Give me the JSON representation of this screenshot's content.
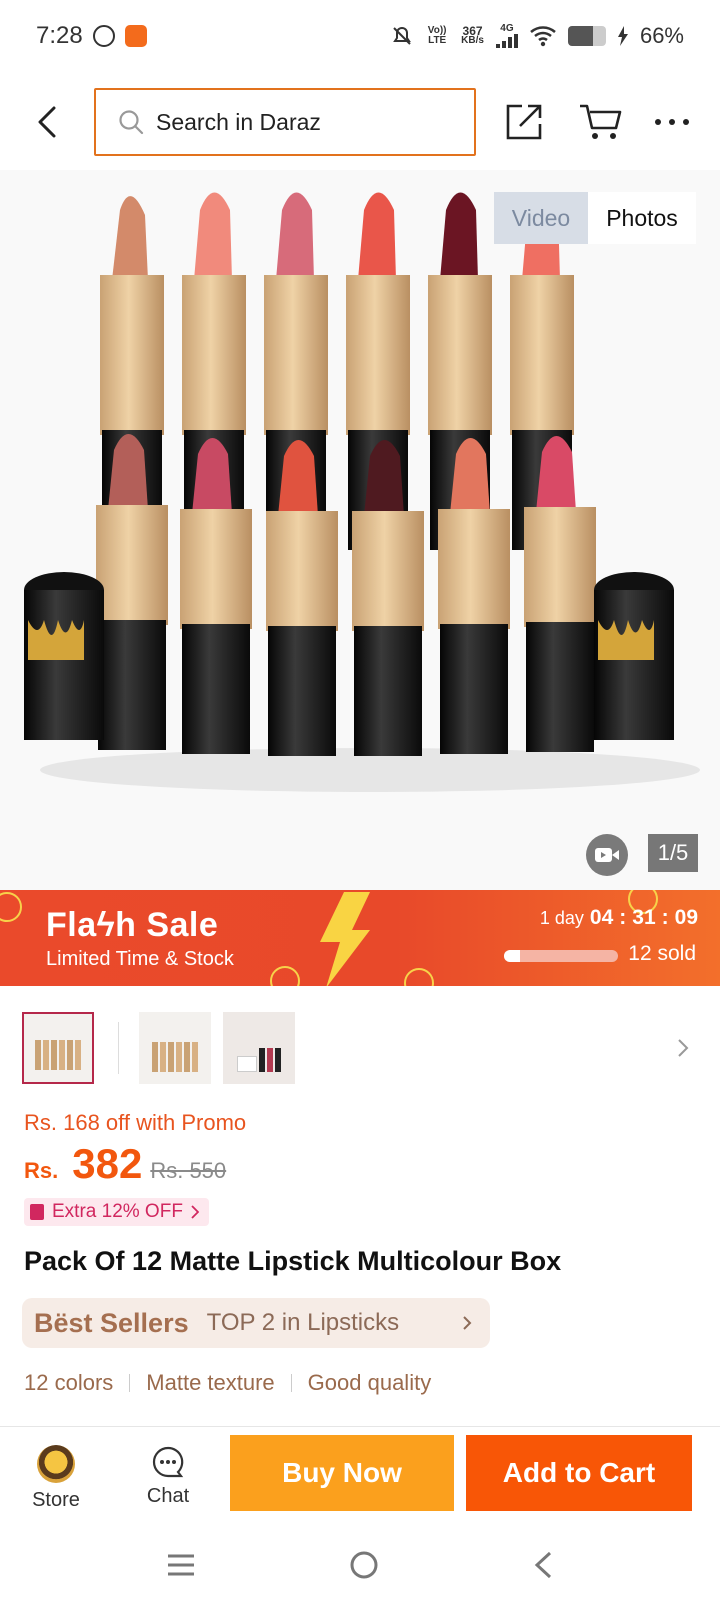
{
  "status_bar": {
    "time": "7:28",
    "volte": "Vo)) LTE",
    "speed_value": "367",
    "speed_unit": "KB/s",
    "network": "4G",
    "battery": "66%"
  },
  "header": {
    "search_placeholder": "Search in Daraz"
  },
  "gallery": {
    "tab_video": "Video",
    "tab_photos": "Photos",
    "counter": "1/5"
  },
  "flash_sale": {
    "title": "Flaϟh Sale",
    "subtitle": "Limited Time & Stock",
    "timer_day": "1 day",
    "timer_h": "04",
    "timer_m": "31",
    "timer_s": "09",
    "progress_fraction": 0.14,
    "sold": "12 sold"
  },
  "product": {
    "promo_text": "Rs. 168 off with Promo",
    "currency": "Rs.",
    "price": "382",
    "old_price": "Rs. 550",
    "extra_off": "Extra 12% OFF",
    "title": "Pack Of 12 Matte Lipstick Multicolour Box",
    "best_sellers_label": "Bëst Sellers",
    "best_sellers_text": "TOP 2 in Lipsticks",
    "tags": [
      "12 colors",
      "Matte texture",
      "Good quality"
    ]
  },
  "action_bar": {
    "store_label": "Store",
    "chat_label": "Chat",
    "buy_now": "Buy Now",
    "add_to_cart": "Add to Cart"
  },
  "colors": {
    "daraz_orange": "#f85606",
    "buy_now_yellow": "#fba01d",
    "flash_red": "#ea4a2b"
  }
}
